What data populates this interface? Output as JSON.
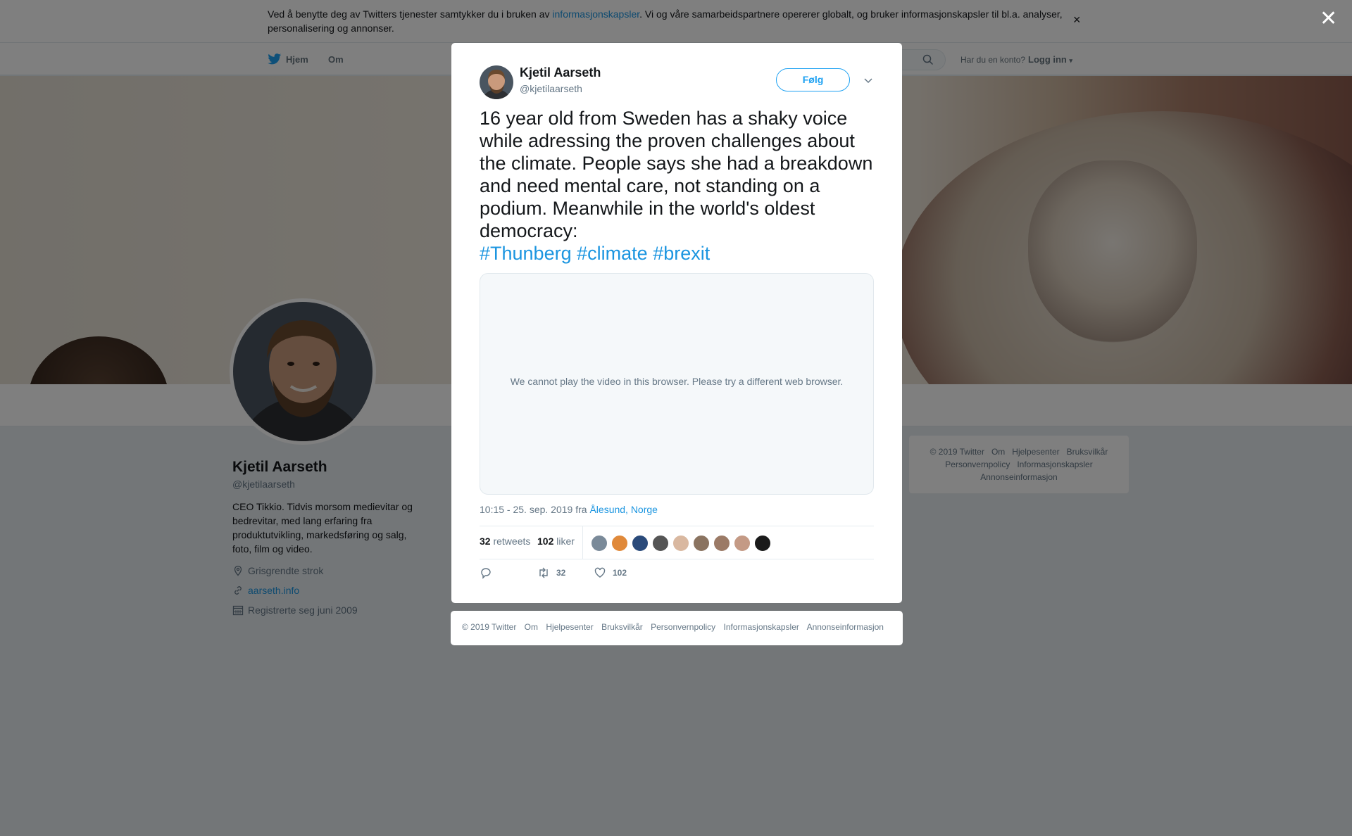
{
  "cookie": {
    "text_before": "Ved å benytte deg av Twitters tjenester samtykker du i bruken av ",
    "link": "informasjonskapsler",
    "text_after": ". Vi og våre samarbeidspartnere opererer globalt, og bruker informasjonskapsler til bl.a. analyser, personalisering og annonser.",
    "close": "×"
  },
  "nav": {
    "home": "Hjem",
    "about": "Om",
    "account_question": "Har du en konto?",
    "login": "Logg inn"
  },
  "profile": {
    "name": "Kjetil Aarseth",
    "handle": "@kjetilaarseth",
    "bio": "CEO Tikkio. Tidvis morsom medievitar og bedrevitar, med lang erfaring fra produktutvikling, markedsføring og salg, foto, film og video.",
    "location": "Grisgrendte strok",
    "website": "aarseth.info",
    "joined": "Registrerte seg juni 2009"
  },
  "side_footer": {
    "items": [
      "© 2019 Twitter",
      "Om",
      "Hjelpesenter",
      "Bruksvilkår",
      "Personvernpolicy",
      "Informasjonskapsler",
      "Annonseinformasjon"
    ]
  },
  "overlay": {
    "close": "✕"
  },
  "tweet": {
    "author_name": "Kjetil Aarseth",
    "author_handle": "@kjetilaarseth",
    "follow_label": "Følg",
    "text": "16 year old from Sweden has a shaky voice while adressing the proven challenges about the climate. People says she had a breakdown and need mental care, not standing on a podium. Meanwhile in the world's oldest democracy:",
    "hashtags": [
      "#Thunberg",
      "#climate",
      "#brexit"
    ],
    "video_message": "We cannot play the video in this browser. Please try a different web browser.",
    "time": "10:15 - 25. sep. 2019 fra ",
    "place": "Ålesund, Norge",
    "retweets_count": "32",
    "retweets_label": "retweets",
    "likes_count": "102",
    "likes_label": "liker",
    "action_retweets": "32",
    "action_likes": "102",
    "liker_colors": [
      "#7a8a99",
      "#e0893a",
      "#2a4a7a",
      "#555555",
      "#d9b8a0",
      "#8a7360",
      "#9b7a66",
      "#c49a85",
      "#1a1a1a"
    ]
  },
  "modal_footer": {
    "items": [
      "© 2019 Twitter",
      "Om",
      "Hjelpesenter",
      "Bruksvilkår",
      "Personvernpolicy",
      "Informasjonskapsler",
      "Annonseinformasjon"
    ]
  },
  "colors": {
    "link": "#1b95e0",
    "follow": "#1da1f2",
    "video_bg": "#f5f8fa"
  }
}
